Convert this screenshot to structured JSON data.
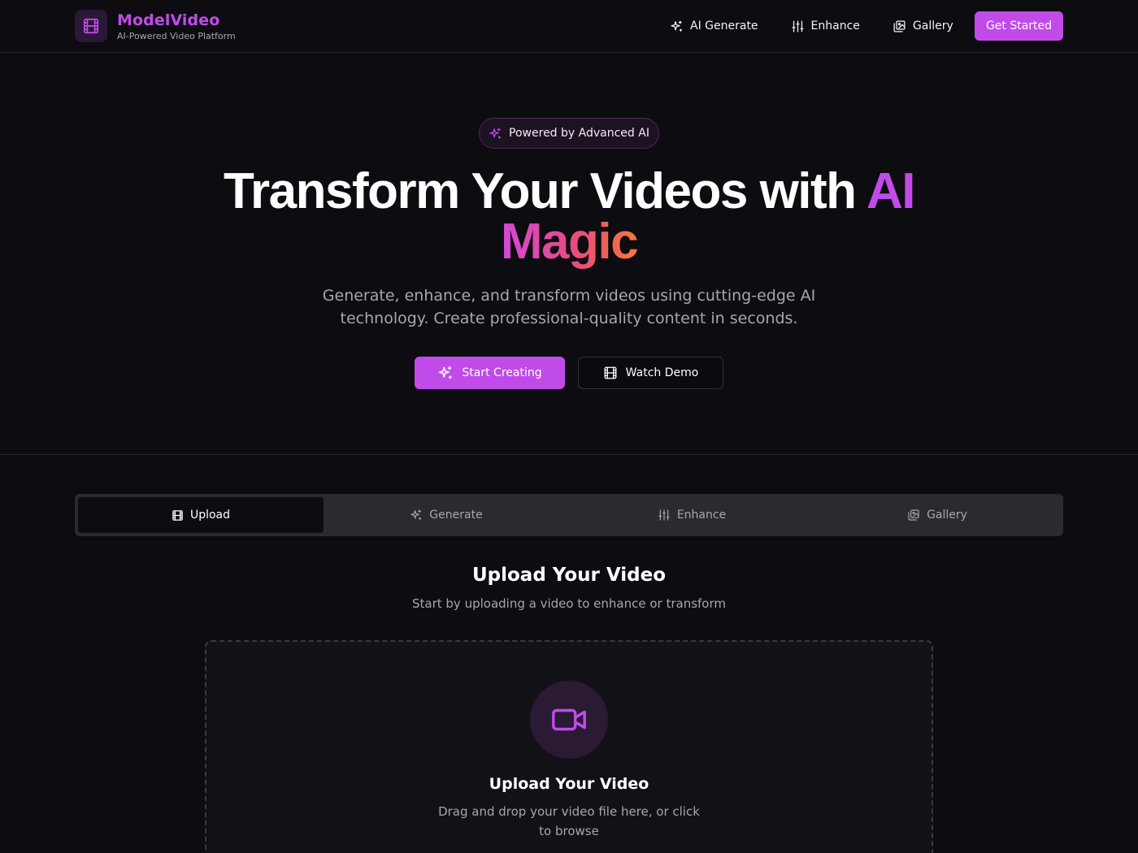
{
  "colors": {
    "accent": "#c14be9",
    "background": "#0d0c10",
    "muted_text": "#a8a6ae",
    "gradient_start": "#d448d8",
    "gradient_end": "#f5773a"
  },
  "brand": {
    "name": "ModelVideo",
    "tagline": "AI-Powered Video Platform",
    "icon": "film-icon"
  },
  "nav": {
    "items": [
      {
        "label": "AI Generate",
        "icon": "sparkles-icon"
      },
      {
        "label": "Enhance",
        "icon": "sliders-icon"
      },
      {
        "label": "Gallery",
        "icon": "gallery-icon"
      }
    ],
    "cta_label": "Get Started"
  },
  "hero": {
    "badge": "Powered by Advanced AI",
    "title_main": "Transform Your Videos with ",
    "title_accent": "AI",
    "title_magic": "Magic",
    "description": "Generate, enhance, and transform videos using cutting-edge AI technology. Create professional-quality content in seconds.",
    "primary_button": "Start Creating",
    "secondary_button": "Watch Demo"
  },
  "tabs": [
    {
      "label": "Upload",
      "icon": "film-icon",
      "active": true
    },
    {
      "label": "Generate",
      "icon": "sparkles-icon",
      "active": false
    },
    {
      "label": "Enhance",
      "icon": "sliders-icon",
      "active": false
    },
    {
      "label": "Gallery",
      "icon": "gallery-icon",
      "active": false
    }
  ],
  "upload": {
    "section_title": "Upload Your Video",
    "section_subtitle": "Start by uploading a video to enhance or transform",
    "dropzone_title": "Upload Your Video",
    "dropzone_description": "Drag and drop your video file here, or click to browse",
    "icon": "video-camera-icon"
  }
}
